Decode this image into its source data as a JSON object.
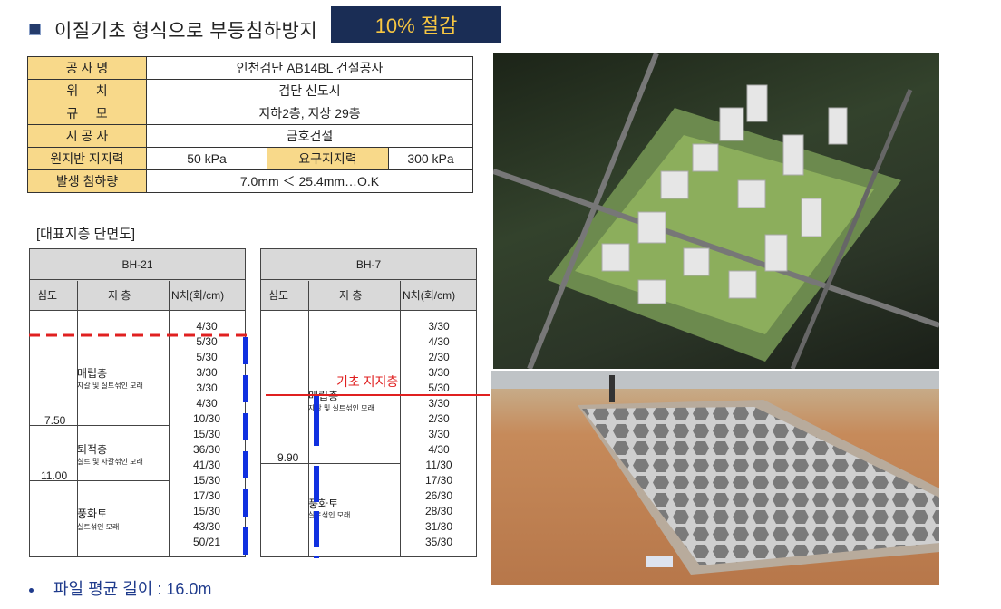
{
  "title": "이질기초 형식으로 부등침하방지",
  "badge": "10% 절감",
  "info": {
    "rows": [
      {
        "label": "공 사 명",
        "value": "인천검단 AB14BL 건설공사"
      },
      {
        "label": "위     치",
        "value": "검단 신도시"
      },
      {
        "label": "규     모",
        "value": "지하2층, 지상 29층"
      },
      {
        "label": "시 공 사",
        "value": "금호건설"
      }
    ],
    "bearing": {
      "label": "원지반 지지력",
      "value": "50 kPa",
      "req_label": "요구지지력",
      "req_value": "300 kPa"
    },
    "settle": {
      "label": "발생 침하량",
      "value": "7.0mm ＜ 25.4mm…O.K"
    }
  },
  "section_label": "[대표지층 단면도]",
  "bh21": {
    "title": "BH-21",
    "col_depth": "심도",
    "col_layer": "지 층",
    "col_n": "N치(회/cm)",
    "depths": [
      "7.50",
      "11.00"
    ],
    "layers": [
      {
        "name": "매립층",
        "desc": "자갈 및 실트섞인 모래"
      },
      {
        "name": "퇴적층",
        "desc": "실트 및 자갈섞인 모래"
      },
      {
        "name": "풍화토",
        "desc": "실트섞인 모래"
      }
    ],
    "n_values": [
      "4/30",
      "5/30",
      "5/30",
      "3/30",
      "3/30",
      "4/30",
      "10/30",
      "15/30",
      "36/30",
      "41/30",
      "15/30",
      "17/30",
      "15/30",
      "43/30",
      "50/21"
    ]
  },
  "bh7": {
    "title": "BH-7",
    "col_depth": "심도",
    "col_layer": "지 층",
    "col_n": "N치(회/cm)",
    "depths": [
      "9.90"
    ],
    "layers": [
      {
        "name": "매립층",
        "desc": "자갈 및 실트섞인 모래"
      },
      {
        "name": "풍화토",
        "desc": "실트섞인 모래"
      }
    ],
    "n_values": [
      "3/30",
      "4/30",
      "2/30",
      "3/30",
      "5/30",
      "3/30",
      "2/30",
      "3/30",
      "4/30",
      "11/30",
      "17/30",
      "26/30",
      "28/30",
      "31/30",
      "35/30"
    ],
    "annotation": "기초 지지층"
  },
  "bullet": "파일 평균 길이 : 16.0m",
  "colors": {
    "badge_bg": "#1a2d55",
    "badge_text": "#f7c642",
    "label_bg": "#f8d98a",
    "dash_red": "#e02020",
    "pile_blue": "#1030e0"
  }
}
